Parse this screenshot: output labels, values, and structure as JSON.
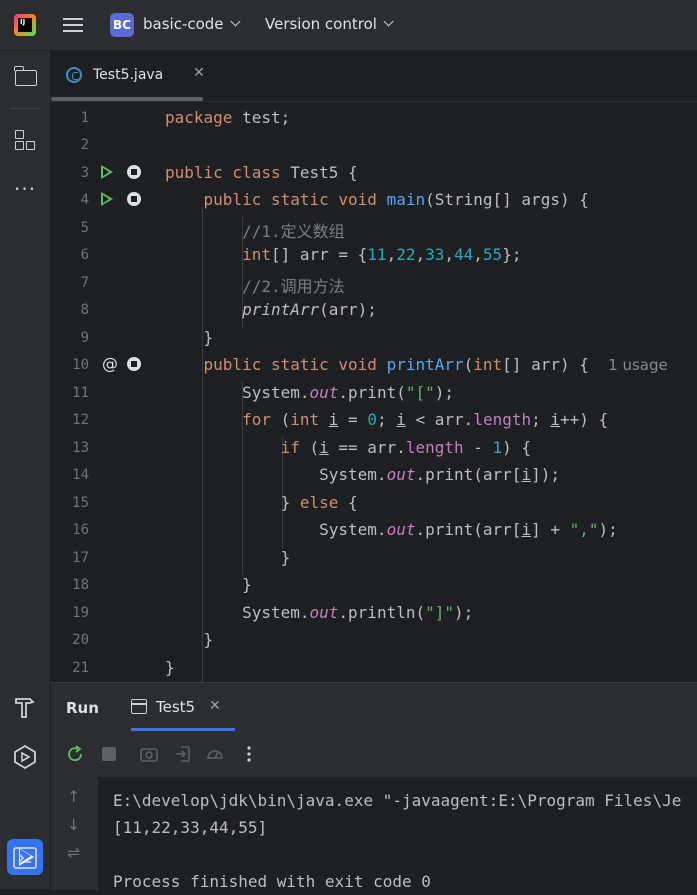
{
  "header": {
    "project_badge": "BC",
    "project_name": "basic-code",
    "vcs_label": "Version control"
  },
  "editor": {
    "tab_label": "Test5.java",
    "tab_close": "✕",
    "usage_hint": "1 usage",
    "line_numbers": [
      "1",
      "2",
      "3",
      "4",
      "5",
      "6",
      "7",
      "8",
      "9",
      "10",
      "11",
      "12",
      "13",
      "14",
      "15",
      "16",
      "17",
      "18",
      "19",
      "20",
      "21"
    ],
    "code": {
      "l1_kw": "package",
      "l1_rest": " test;",
      "l3_kw": "public class",
      "l3_rest": " Test5 {",
      "l4_kw": "public static void",
      "l4_fn": "main",
      "l4_rest": "(String[] args) {",
      "l5_comment": "//1.定义数组",
      "l6_kw": "int",
      "l6_mid": "[] arr = {",
      "l6_nums": [
        "11",
        "22",
        "33",
        "44",
        "55"
      ],
      "l6_end": "};",
      "l7_comment": "//2.调用方法",
      "l8_call": "printArr",
      "l8_rest": "(arr);",
      "l9": "}",
      "l10_kw": "public static void",
      "l10_fn": "printArr",
      "l10_p1": "(",
      "l10_int": "int",
      "l10_p2": "[] arr) {",
      "l11_a": "System.",
      "l11_out": "out",
      "l11_b": ".print(",
      "l11_str": "\"[\"",
      "l11_c": ");",
      "l12_for": "for",
      "l12_a": " (",
      "l12_int": "int",
      "l12_i": "i",
      "l12_eq": " = ",
      "l12_zero": "0",
      "l12_b": "; ",
      "l12_i2": "i",
      "l12_c": " < arr.",
      "l12_len": "length",
      "l12_d": "; ",
      "l12_i3": "i",
      "l12_e": "++) {",
      "l13_if": "if",
      "l13_a": " (",
      "l13_i": "i",
      "l13_b": " == arr.",
      "l13_len": "length",
      "l13_c": " - ",
      "l13_one": "1",
      "l13_d": ") {",
      "l14_a": "System.",
      "l14_out": "out",
      "l14_b": ".print(arr[",
      "l14_i": "i",
      "l14_c": "]);",
      "l15_a": "} ",
      "l15_else": "else",
      "l15_b": " {",
      "l16_a": "System.",
      "l16_out": "out",
      "l16_b": ".print(arr[",
      "l16_i": "i",
      "l16_c": "] + ",
      "l16_str": "\",\"",
      "l16_d": ");",
      "l17": "}",
      "l18": "}",
      "l19_a": "System.",
      "l19_out": "out",
      "l19_b": ".println(",
      "l19_str": "\"]\"",
      "l19_c": ");",
      "l20": "}",
      "l21": "}"
    }
  },
  "run": {
    "title": "Run",
    "tab_label": "Test5",
    "tab_close": "✕",
    "console_lines": [
      "E:\\develop\\jdk\\bin\\java.exe \"-javaagent:E:\\Program Files\\Je",
      "[11,22,33,44,55]",
      "",
      "Process finished with exit code 0"
    ]
  },
  "colors": {
    "accent": "#3574f0",
    "keyword": "#cf8e6d",
    "function": "#56a8f5",
    "number": "#2aacb8",
    "string": "#6aab73",
    "comment": "#7a7e85",
    "field": "#c77dbb"
  },
  "icons": [
    "jetbrains-logo-icon",
    "hamburger-menu-icon",
    "folder-icon",
    "structure-icon",
    "more-icon",
    "build-hammer-icon",
    "services-icon",
    "run-icon",
    "terminal-icon",
    "rerun-icon",
    "stop-icon",
    "camera-icon",
    "exit-icon",
    "profiler-icon",
    "kebab-icon",
    "arrow-up-icon",
    "arrow-down-icon",
    "soft-wrap-icon"
  ]
}
